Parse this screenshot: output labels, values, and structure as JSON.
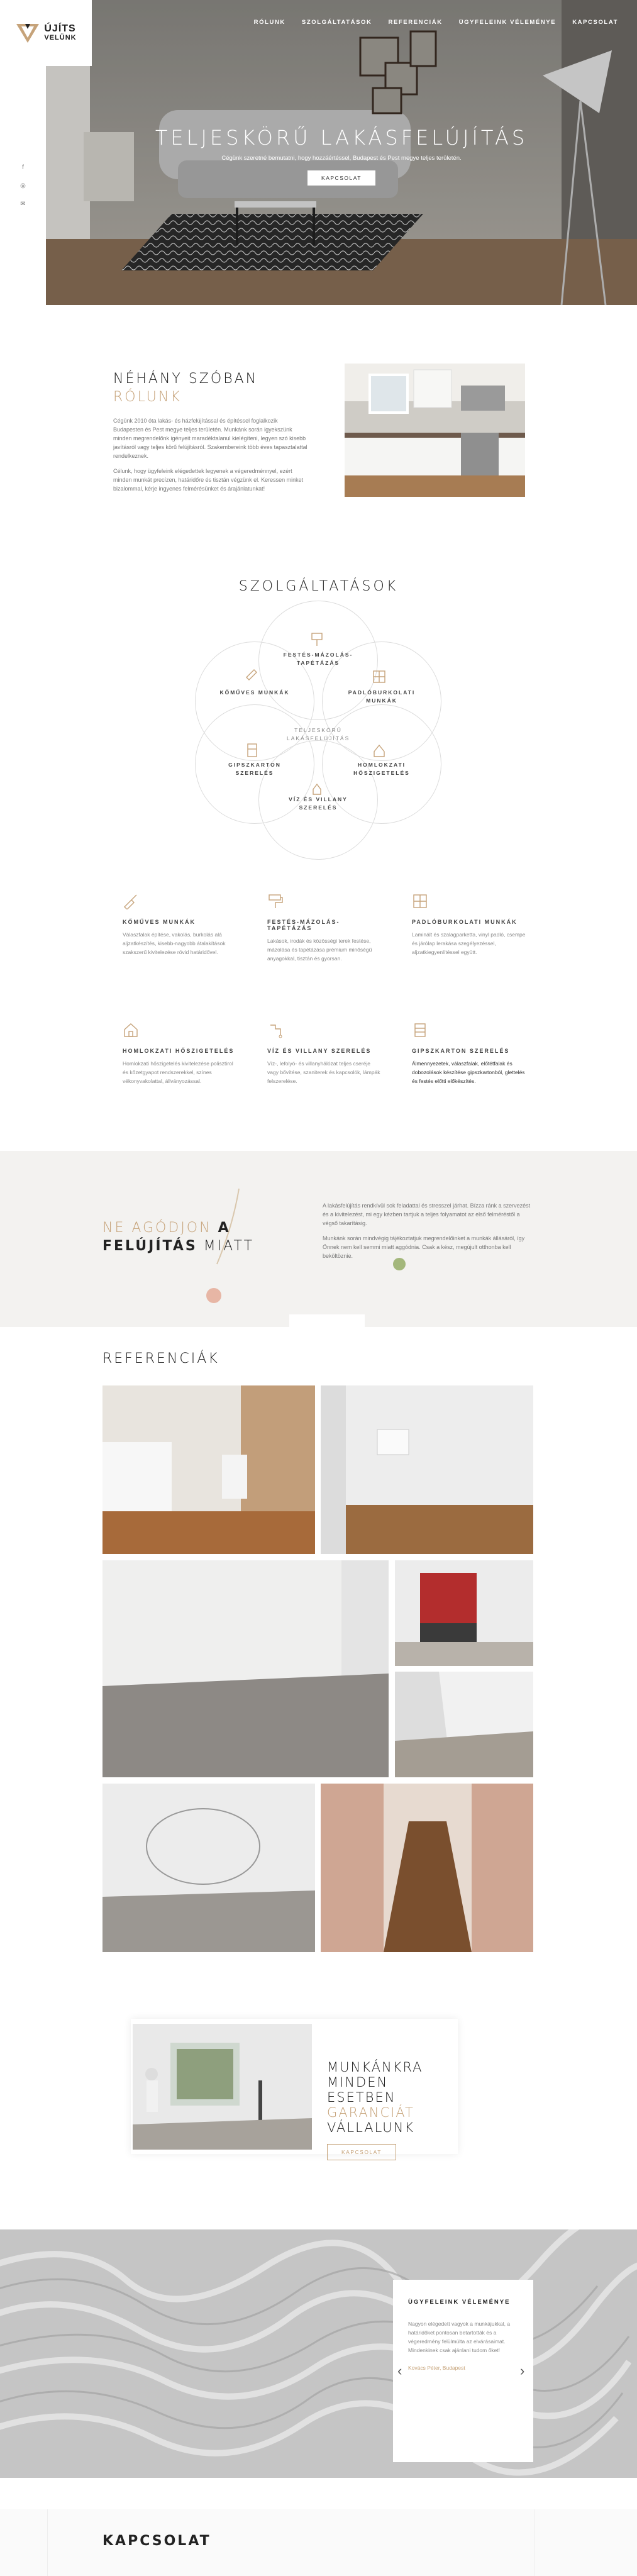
{
  "logo": {
    "line1": "ÚJÍTS",
    "line2": "VELÜNK"
  },
  "nav": [
    "RÓLUNK",
    "SZOLGÁLTATÁSOK",
    "REFERENCIÁK",
    "ÜGYFELEINK VÉLEMÉNYE",
    "KAPCSOLAT"
  ],
  "social": {
    "facebook": "f",
    "instagram": "◎",
    "email": "✉"
  },
  "hero": {
    "title": "TELJESKÖRŰ LAKÁSFELÚJÍTÁS",
    "subtitle": "Cégünk szeretné bemutatni, hogy hozzáértéssel, Budapest és Pest megye teljes területén.",
    "button": "KAPCSOLAT"
  },
  "about": {
    "title1": "NÉHÁNY SZÓBAN",
    "title2": "RÓLUNK",
    "p1": "Cégünk 2010 óta lakás- és házfelújítással és építéssel foglalkozik Budapesten és Pest megye teljes területén. Munkánk során igyekszünk minden megrendelőnk igényeit maradéktalanul kielégíteni, legyen szó kisebb javításról vagy teljes körű felújításról. Szakembereink több éves tapasztalattal rendelkeznek.",
    "p2": "Célunk, hogy ügyfeleink elégedettek legyenek a végeredménnyel, ezért minden munkát precízen, határidőre és tisztán végzünk el. Keressen minket bizalommal, kérje ingyenes felmérésünket és árajánlatunkat!"
  },
  "services": {
    "title": "SZOLGÁLTATÁSOK",
    "circles": [
      {
        "label": "FESTÉS-MÁZOLÁS-TAPÉTÁZÁS",
        "icon": "paint-roller-icon"
      },
      {
        "label": "KŐMŰVES MUNKÁK",
        "icon": "trowel-icon"
      },
      {
        "label": "PADLÓBURKOLATI MUNKÁK",
        "icon": "floor-tiles-icon"
      },
      {
        "label": "TELJESKÖRŰ LAKÁSFELÚJÍTÁS",
        "icon": ""
      },
      {
        "label": "GIPSZKARTON SZERELÉS",
        "icon": "drywall-icon"
      },
      {
        "label": "HOMLOKZATI HŐSZIGETELÉS",
        "icon": "facade-icon"
      },
      {
        "label": "VÍZ ÉS VILLANY SZERELÉS",
        "icon": "plumbing-icon"
      }
    ],
    "items": [
      {
        "title": "KŐMŰVES MUNKÁK",
        "text": "Válaszfalak építése, vakolás, burkolás alá aljzatkészítés, kisebb-nagyobb átalakítások szakszerű kivitelezése rövid határidővel.",
        "icon": "trowel-icon"
      },
      {
        "title": "FESTÉS-MÁZOLÁS-TAPÉTÁZÁS",
        "text": "Lakások, irodák és közösségi terek festése, mázolása és tapétázása prémium minőségű anyagokkal, tisztán és gyorsan.",
        "icon": "paint-roller-icon"
      },
      {
        "title": "PADLÓBURKOLATI MUNKÁK",
        "text": "Laminált és szalagparketta, vinyl padló, csempe és járólap lerakása szegélyezéssel, aljzatkiegyenlítéssel együtt.",
        "icon": "floor-tiles-icon"
      },
      {
        "title": "HOMLOKZATI HŐSZIGETELÉS",
        "text": "Homlokzati hőszigetelés kivitelezése polisztirol és kőzetgyapot rendszerekkel, színes vékonyvakolattal, állványozással.",
        "icon": "facade-icon"
      },
      {
        "title": "VÍZ ÉS VILLANY SZERELÉS",
        "text": "Víz-, lefolyó- és villanyhálózat teljes cseréje vagy bővítése, szaniterek és kapcsolók, lámpák felszerelése.",
        "icon": "plumbing-icon"
      },
      {
        "title": "GIPSZKARTON SZERELÉS",
        "text": "Álmennyezetek, válaszfalak, előtétfalak és dobozolások készítése gipszkartonból, glettelés és festés előtti előkészítés.",
        "icon": "drywall-icon"
      }
    ]
  },
  "worry": {
    "line1a": "NE AGÓDJON",
    "line1b": "A",
    "line2a": "FELÚJÍTÁS",
    "line2b": "MIATT",
    "p1": "A lakásfelújítás rendkívül sok feladattal és stresszel járhat. Bízza ránk a szervezést és a kivitelezést, mi egy kézben tartjuk a teljes folyamatot az első felméréstől a végső takarításig.",
    "p2": "Munkánk során mindvégig tájékoztatjuk megrendelőinket a munkák állásáról, így Önnek nem kell semmi miatt aggódnia. Csak a kész, megújult otthonba kell beköltöznie."
  },
  "references": {
    "title": "REFERENCIÁK"
  },
  "guarantee": {
    "line1": "MUNKÁNKRA MINDEN",
    "line2a": "ESETBEN",
    "line2b": "GARANCIÁT",
    "line3": "VÁLLALUNK",
    "button": "KAPCSOLAT"
  },
  "testimonials": {
    "title": "ÜGYFELEINK VÉLEMÉNYE",
    "text": "Nagyon elégedett vagyok a munkájukkal, a határidőket pontosan betartották és a végeredmény felülmúlta az elvárásaimat. Mindenkinek csak ajánlani tudom őket!",
    "author": "Kovács Péter, Budapest",
    "prev": "‹",
    "next": "›"
  },
  "contact": {
    "title": "KAPCSOLAT"
  },
  "colors": {
    "accent": "#c6a37a",
    "dark": "#222222"
  }
}
